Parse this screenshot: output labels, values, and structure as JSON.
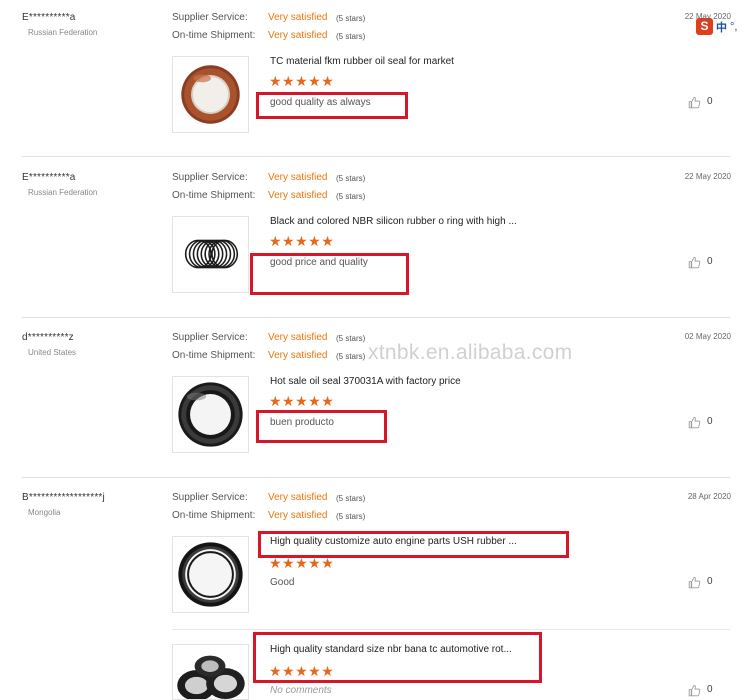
{
  "ratings": {
    "supplier_label": "Supplier Service:",
    "shipment_label": "On-time Shipment:"
  },
  "ime_toolbar": {
    "logo": "S",
    "language": "中",
    "punctuation": "°,"
  },
  "watermark": "xtnbk.en.alibaba.com",
  "reviews": [
    {
      "buyer": "E**********a",
      "country": "Russian Federation",
      "date": "22 May 2020",
      "supplier_value": "Very satisfied",
      "supplier_stars": "(5 stars)",
      "shipment_value": "Very satisfied",
      "shipment_stars": "(5 stars)",
      "products": [
        {
          "title": "TC material fkm rubber oil seal for market",
          "stars": "★★★★★",
          "rating": 5,
          "comment": "good quality as always",
          "likes": "0"
        }
      ]
    },
    {
      "buyer": "E**********a",
      "country": "Russian Federation",
      "date": "22 May 2020",
      "supplier_value": "Very satisfied",
      "supplier_stars": "(5 stars)",
      "shipment_value": "Very satisfied",
      "shipment_stars": "(5 stars)",
      "products": [
        {
          "title": "Black and colored NBR silicon rubber o ring with high ...",
          "stars": "★★★★★",
          "rating": 5,
          "comment": "good price and quality",
          "likes": "0"
        }
      ]
    },
    {
      "buyer": "d**********z",
      "country": "United States",
      "date": "02 May 2020",
      "supplier_value": "Very satisfied",
      "supplier_stars": "(5 stars)",
      "shipment_value": "Very satisfied",
      "shipment_stars": "(5 stars)",
      "products": [
        {
          "title": "Hot sale oil seal 370031A with factory price",
          "stars": "★★★★★",
          "rating": 5,
          "comment": "buen producto",
          "likes": "0"
        }
      ]
    },
    {
      "buyer": "B******************j",
      "country": "Mongolia",
      "date": "28 Apr 2020",
      "supplier_value": "Very satisfied",
      "supplier_stars": "(5 stars)",
      "shipment_value": "Very satisfied",
      "shipment_stars": "(5 stars)",
      "products": [
        {
          "title": "High quality customize auto engine parts USH rubber ...",
          "stars": "★★★★★",
          "rating": 5,
          "comment": "Good",
          "likes": "0"
        },
        {
          "title": "High quality standard size nbr bana tc automotive rot...",
          "stars": "★★★★★",
          "rating": 5,
          "comment": "No comments",
          "likes": "0"
        }
      ]
    }
  ]
}
